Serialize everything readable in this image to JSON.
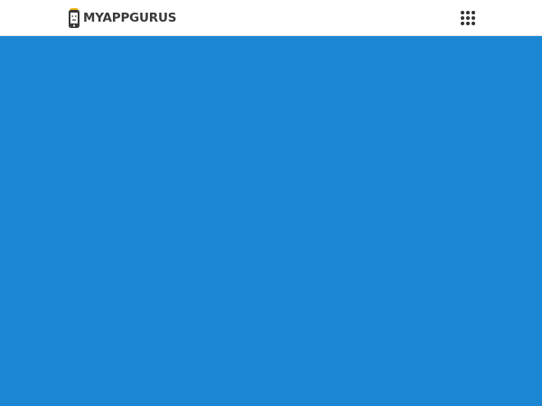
{
  "header": {
    "logo_text": "MYAPPGURUS",
    "logo_icon": "phone-logo-icon",
    "menu_icon": "grid-menu-icon"
  },
  "colors": {
    "header_background": "#ffffff",
    "hero_background": "#1b86d3",
    "logo_text": "#3a3a3a",
    "logo_accent": "#f2b21a",
    "menu_icon": "#333333"
  }
}
